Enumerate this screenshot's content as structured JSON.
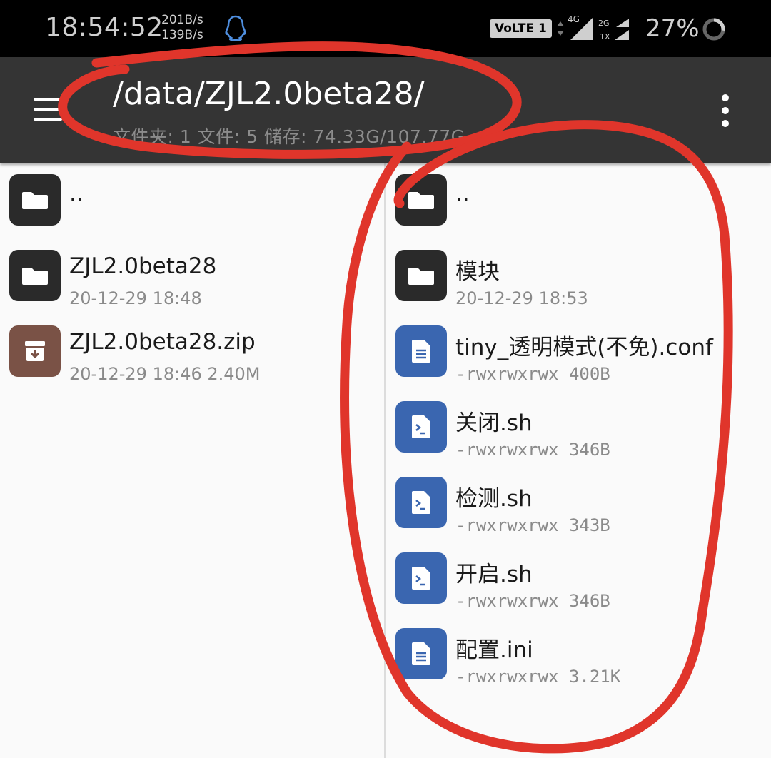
{
  "status_bar": {
    "time": "18:54:52",
    "speed_up": "201B/s",
    "speed_down": "139B/s",
    "volte": "VoLTE 1",
    "sig1_label": "4G",
    "sig2_label_top": "2G",
    "sig2_label_bottom": "1X",
    "battery": "27%",
    "battery_level": 0.27
  },
  "toolbar": {
    "path": "/data/ZJL2.0beta28/",
    "summary": "文件夹: 1  文件: 5  储存: 74.33G/107.77G"
  },
  "left_pane": {
    "items": [
      {
        "name": "..",
        "meta": "",
        "icon": "folder-icon"
      },
      {
        "name": "ZJL2.0beta28",
        "meta": "20-12-29 18:48",
        "icon": "folder-icon"
      },
      {
        "name": "ZJL2.0beta28.zip",
        "meta": "20-12-29 18:46  2.40M",
        "icon": "archive-icon"
      }
    ]
  },
  "right_pane": {
    "items": [
      {
        "name": "..",
        "meta": "",
        "icon": "folder-icon"
      },
      {
        "name": "模块",
        "meta": "20-12-29 18:53",
        "icon": "folder-icon"
      },
      {
        "name": "tiny_透明模式(不免).conf",
        "meta": "-rwxrwxrwx 400B",
        "icon": "document-icon"
      },
      {
        "name": "关闭.sh",
        "meta": "-rwxrwxrwx 346B",
        "icon": "script-icon"
      },
      {
        "name": "检测.sh",
        "meta": "-rwxrwxrwx 343B",
        "icon": "script-icon"
      },
      {
        "name": "开启.sh",
        "meta": "-rwxrwxrwx 346B",
        "icon": "script-icon"
      },
      {
        "name": "配置.ini",
        "meta": "-rwxrwxrwx 3.21K",
        "icon": "document-icon"
      }
    ]
  },
  "colors": {
    "status_bg": "#000000",
    "toolbar_bg": "#343434",
    "folder_icon_bg": "#2a2a2a",
    "zip_icon_bg": "#7a5246",
    "doc_icon_bg": "#3a66b0",
    "annotation": "#e0352b"
  }
}
